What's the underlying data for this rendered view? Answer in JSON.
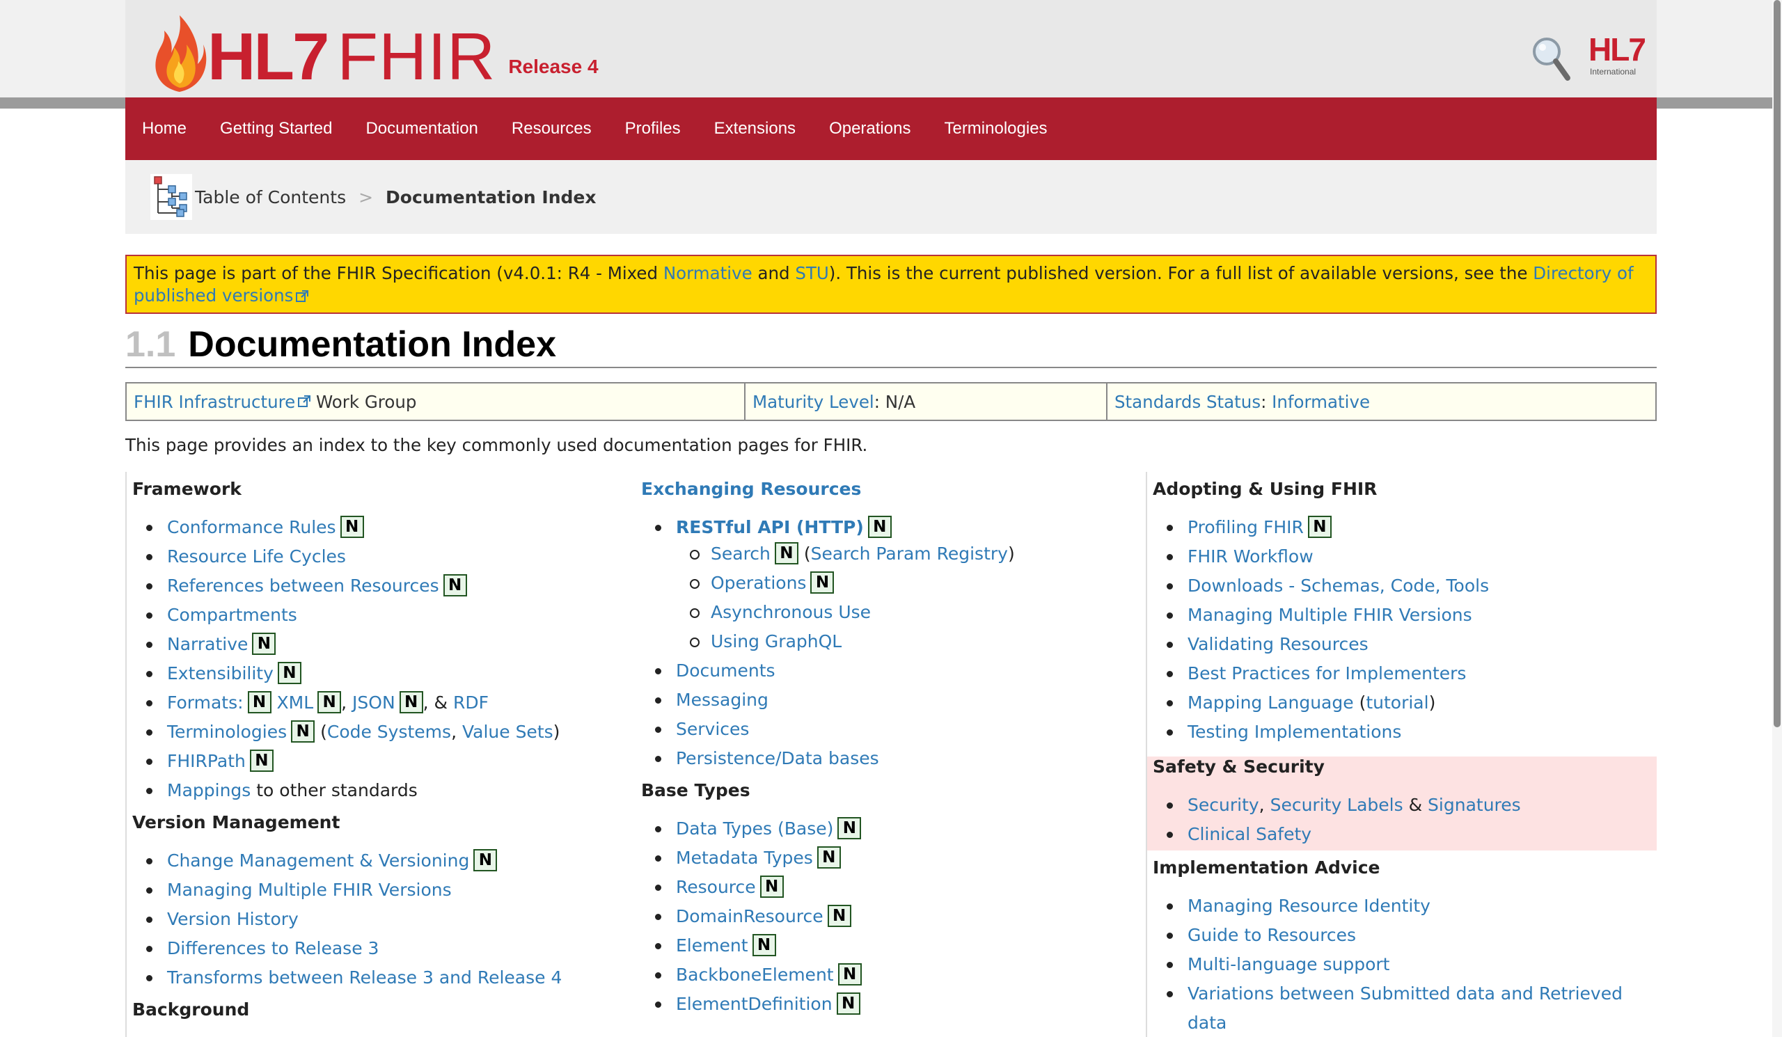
{
  "header": {
    "logo_hl7": "HL7",
    "logo_fhir": "FHIR",
    "release": "Release 4",
    "intl_big": "HL7",
    "intl_small": "International"
  },
  "nav": [
    "Home",
    "Getting Started",
    "Documentation",
    "Resources",
    "Profiles",
    "Extensions",
    "Operations",
    "Terminologies"
  ],
  "breadcrumb": {
    "toc": "Table of Contents",
    "sep": ">",
    "current": "Documentation Index"
  },
  "banner": {
    "t1": "This page is part of the FHIR Specification (v4.0.1: R4 - Mixed ",
    "normative": "Normative",
    "t2": " and ",
    "stu": "STU",
    "t3": "). This is the current published version. For a full list of available versions, see the ",
    "dir": "Directory of published versions"
  },
  "title": {
    "num": "1.1",
    "text": "Documentation Index"
  },
  "meta": {
    "wg_link": "FHIR Infrastructure",
    "wg_text": " Work Group",
    "maturity_label": "Maturity Level",
    "maturity_value": ": N/A",
    "status_label": "Standards Status",
    "status_sep": ": ",
    "status_value": "Informative"
  },
  "intro": "This page provides an index to the key commonly used documentation pages for FHIR.",
  "badge": "N",
  "col1": {
    "framework_heading": "Framework",
    "conformance": "Conformance Rules",
    "lifecycles": "Resource Life Cycles",
    "references": "References between Resources",
    "compartments": "Compartments",
    "narrative": "Narrative",
    "extensibility": "Extensibility",
    "formats": "Formats:",
    "xml": "XML",
    "json": "JSON",
    "amp": ", & ",
    "rdf": "RDF",
    "terminologies": "Terminologies",
    "code_systems": "Code Systems",
    "value_sets": "Value Sets",
    "fhirpath": "FHIRPath",
    "mappings": "Mappings",
    "mappings_text": " to other standards",
    "vm_heading": "Version Management",
    "change_mgmt": "Change Management & Versioning",
    "multi_versions": "Managing Multiple FHIR Versions",
    "history": "Version History",
    "diffs": "Differences to Release 3",
    "transforms": "Transforms between Release 3 and Release 4",
    "background_heading": "Background"
  },
  "col2": {
    "exch_heading": "Exchanging Resources",
    "restful": "RESTful API (HTTP)",
    "search": "Search",
    "search_param": "Search Param Registry",
    "operations": "Operations",
    "async": "Asynchronous Use",
    "graphql": "Using GraphQL",
    "documents": "Documents",
    "messaging": "Messaging",
    "services": "Services",
    "persistence": "Persistence/Data bases",
    "base_heading": "Base Types",
    "datatypes": "Data Types (Base)",
    "metadata": "Metadata Types",
    "resource": "Resource",
    "domainresource": "DomainResource",
    "element": "Element",
    "backbone": "BackboneElement",
    "elementdef": "ElementDefinition"
  },
  "col3": {
    "adopt_heading": "Adopting & Using FHIR",
    "profiling": "Profiling FHIR",
    "workflow": "FHIR Workflow",
    "downloads": "Downloads - Schemas, Code, Tools",
    "multi": "Managing Multiple FHIR Versions",
    "validating": "Validating Resources",
    "best": "Best Practices for Implementers",
    "mapping": "Mapping Language",
    "tutorial": "tutorial",
    "testing": "Testing Implementations",
    "safety_heading": "Safety & Security",
    "security": "Security",
    "sec_labels": "Security Labels",
    "amp": " & ",
    "signatures": "Signatures",
    "clinical": "Clinical Safety",
    "impl_heading": "Implementation Advice",
    "identity": "Managing Resource Identity",
    "guide": "Guide to Resources",
    "multilang": "Multi-language support",
    "variations": "Variations between Submitted data and Retrieved data"
  }
}
